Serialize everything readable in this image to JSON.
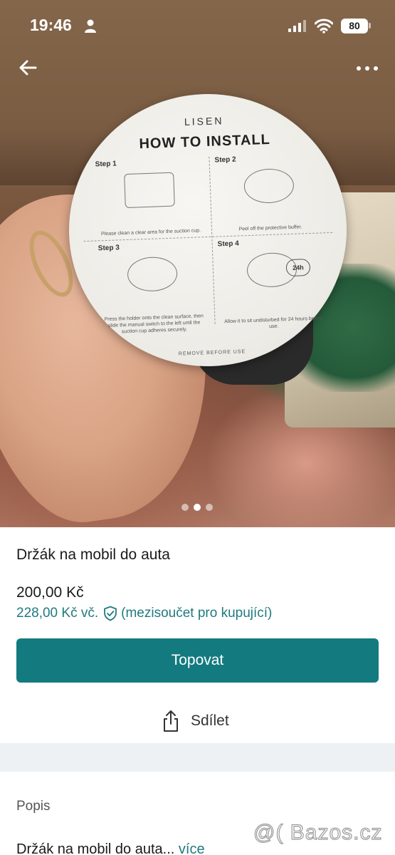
{
  "status_bar": {
    "time": "19:46",
    "battery": "80"
  },
  "photo": {
    "label_brand": "LISEN",
    "label_title": "HOW TO INSTALL",
    "steps": [
      {
        "title": "Step 1",
        "text": "Please clean a clear area for the suction cup."
      },
      {
        "title": "Step 2",
        "text": "Peel off the protective buffer."
      },
      {
        "title": "Step 3",
        "text": "Press the holder onto the clean surface, then slide the manual switch to the left until the suction cup adheres securely."
      },
      {
        "title": "Step 4",
        "text": "Allow it to sit undisturbed for 24 hours before use.",
        "badge": "24h"
      }
    ],
    "label_footer": "REMOVE BEFORE USE",
    "carousel": {
      "count": 3,
      "active_index": 1
    }
  },
  "listing": {
    "title": "Držák na mobil do auta",
    "price": "200,00 Kč",
    "buyer_price": "228,00 Kč vč.",
    "buyer_note": "(mezisoučet pro kupující)",
    "top_button": "Topovat",
    "share_label": "Sdílet"
  },
  "description": {
    "heading": "Popis",
    "text": "Držák na mobil do auta...",
    "more": "více"
  },
  "watermark": "@( Bazos.cz",
  "colors": {
    "accent": "#137a80",
    "link": "#1f7a80",
    "divider": "#eef1f3"
  }
}
